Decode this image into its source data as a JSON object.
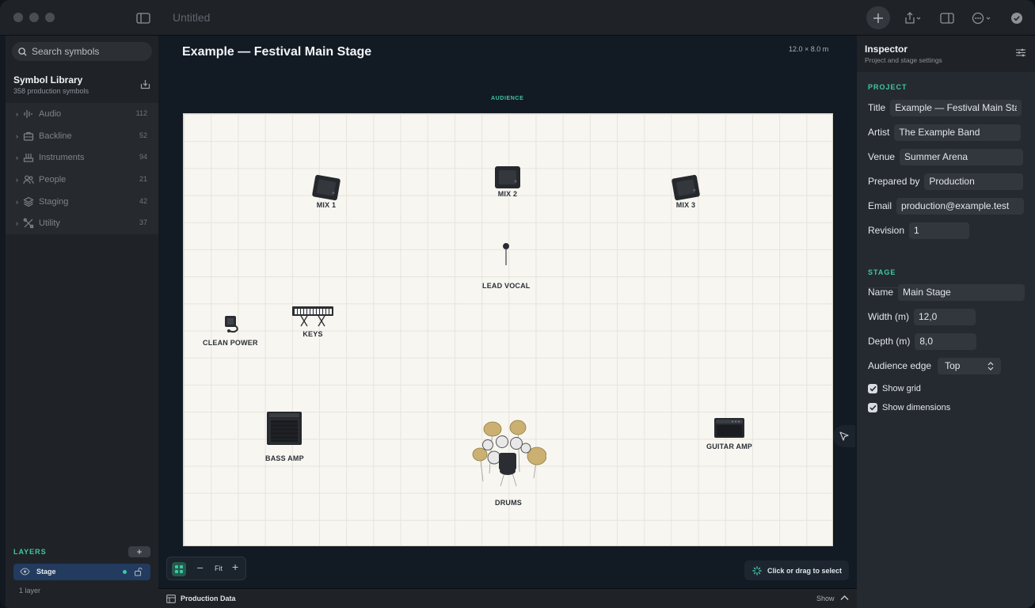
{
  "window": {
    "title": "Untitled"
  },
  "sidebar": {
    "search_placeholder": "Search symbols",
    "library_title": "Symbol Library",
    "library_subtitle": "358 production symbols",
    "categories": [
      {
        "label": "Audio",
        "count": "112",
        "icon": "audio-waveform-icon"
      },
      {
        "label": "Backline",
        "count": "52",
        "icon": "backline-case-icon"
      },
      {
        "label": "Instruments",
        "count": "94",
        "icon": "instruments-icon"
      },
      {
        "label": "People",
        "count": "21",
        "icon": "people-icon"
      },
      {
        "label": "Staging",
        "count": "42",
        "icon": "staging-layers-icon"
      },
      {
        "label": "Utility",
        "count": "37",
        "icon": "utility-tools-icon"
      }
    ],
    "layers_heading": "LAYERS",
    "layers_add": "+",
    "layer": {
      "name": "Stage"
    },
    "layer_count": "1 layer"
  },
  "canvas": {
    "title": "Example — Festival Main Stage",
    "dimensions": "12.0 × 8.0 m",
    "audience_label": "AUDIENCE",
    "symbols": {
      "mix1": "MIX 1",
      "mix2": "MIX 2",
      "mix3": "MIX 3",
      "lead_vocal": "LEAD VOCAL",
      "clean_power": "CLEAN POWER",
      "keys": "KEYS",
      "bass_amp": "BASS AMP",
      "drums": "DRUMS",
      "guitar_amp": "GUITAR AMP"
    },
    "zoom": {
      "minus": "–",
      "fit": "Fit",
      "plus": "+"
    },
    "hint": "Click or drag to select"
  },
  "footer": {
    "label": "Production Data",
    "show": "Show"
  },
  "inspector": {
    "title": "Inspector",
    "subtitle": "Project and stage settings",
    "project_heading": "PROJECT",
    "project": {
      "title_label": "Title",
      "title_value": "Example — Festival Main Stage",
      "artist_label": "Artist",
      "artist_value": "The Example Band",
      "venue_label": "Venue",
      "venue_value": "Summer Arena",
      "prepared_label": "Prepared by",
      "prepared_value": "Production",
      "email_label": "Email",
      "email_value": "production@example.test",
      "revision_label": "Revision",
      "revision_value": "1"
    },
    "stage_heading": "STAGE",
    "stage": {
      "name_label": "Name",
      "name_value": "Main Stage",
      "width_label": "Width (m)",
      "width_value": "12,0",
      "depth_label": "Depth (m)",
      "depth_value": "8,0",
      "audience_label": "Audience edge",
      "audience_value": "Top",
      "show_grid": "Show grid",
      "show_dimensions": "Show dimensions"
    }
  },
  "colors": {
    "accent": "#3fc7a3",
    "stage_bg": "#f8f6f0",
    "selected_layer": "#223b5e"
  }
}
